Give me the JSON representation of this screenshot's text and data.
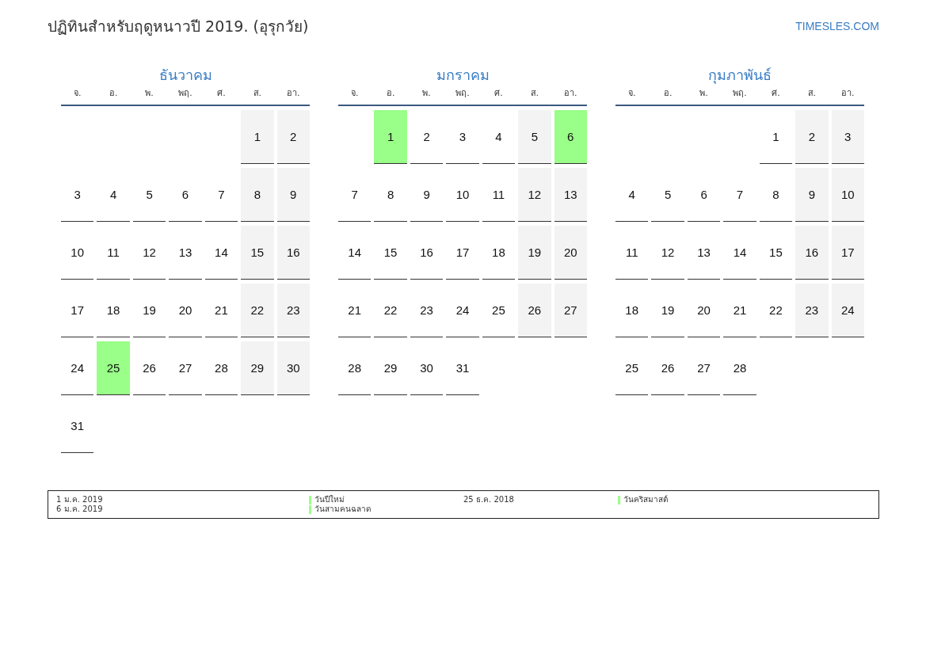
{
  "title": "ปฏิทินสำหรับฤดูหนาวปี 2019. (อุรุกวัย)",
  "site": "TIMESLES.COM",
  "months": [
    {
      "name": "ธันวาคม",
      "weekdays": [
        "จ.",
        "อ.",
        "พ.",
        "พฤ.",
        "ศ.",
        "ส.",
        "อา."
      ],
      "weeks": [
        [
          {
            "kind": "empty"
          },
          {
            "kind": "empty"
          },
          {
            "kind": "empty"
          },
          {
            "kind": "empty"
          },
          {
            "kind": "empty"
          },
          {
            "d": "1",
            "kind": "weekend"
          },
          {
            "d": "2",
            "kind": "weekend"
          }
        ],
        [
          {
            "d": "3",
            "kind": "day"
          },
          {
            "d": "4",
            "kind": "day"
          },
          {
            "d": "5",
            "kind": "day"
          },
          {
            "d": "6",
            "kind": "day"
          },
          {
            "d": "7",
            "kind": "day"
          },
          {
            "d": "8",
            "kind": "weekend"
          },
          {
            "d": "9",
            "kind": "weekend"
          }
        ],
        [
          {
            "d": "10",
            "kind": "day"
          },
          {
            "d": "11",
            "kind": "day"
          },
          {
            "d": "12",
            "kind": "day"
          },
          {
            "d": "13",
            "kind": "day"
          },
          {
            "d": "14",
            "kind": "day"
          },
          {
            "d": "15",
            "kind": "weekend"
          },
          {
            "d": "16",
            "kind": "weekend"
          }
        ],
        [
          {
            "d": "17",
            "kind": "day"
          },
          {
            "d": "18",
            "kind": "day"
          },
          {
            "d": "19",
            "kind": "day"
          },
          {
            "d": "20",
            "kind": "day"
          },
          {
            "d": "21",
            "kind": "day"
          },
          {
            "d": "22",
            "kind": "weekend"
          },
          {
            "d": "23",
            "kind": "weekend"
          }
        ],
        [
          {
            "d": "24",
            "kind": "day"
          },
          {
            "d": "25",
            "kind": "holiday"
          },
          {
            "d": "26",
            "kind": "day"
          },
          {
            "d": "27",
            "kind": "day"
          },
          {
            "d": "28",
            "kind": "day"
          },
          {
            "d": "29",
            "kind": "weekend"
          },
          {
            "d": "30",
            "kind": "weekend"
          }
        ],
        [
          {
            "d": "31",
            "kind": "day"
          }
        ]
      ]
    },
    {
      "name": "มกราคม",
      "weekdays": [
        "จ.",
        "อ.",
        "พ.",
        "พฤ.",
        "ศ.",
        "ส.",
        "อา."
      ],
      "weeks": [
        [
          {
            "kind": "empty"
          },
          {
            "d": "1",
            "kind": "holiday"
          },
          {
            "d": "2",
            "kind": "day"
          },
          {
            "d": "3",
            "kind": "day"
          },
          {
            "d": "4",
            "kind": "day"
          },
          {
            "d": "5",
            "kind": "weekend"
          },
          {
            "d": "6",
            "kind": "holiday"
          }
        ],
        [
          {
            "d": "7",
            "kind": "day"
          },
          {
            "d": "8",
            "kind": "day"
          },
          {
            "d": "9",
            "kind": "day"
          },
          {
            "d": "10",
            "kind": "day"
          },
          {
            "d": "11",
            "kind": "day"
          },
          {
            "d": "12",
            "kind": "weekend"
          },
          {
            "d": "13",
            "kind": "weekend"
          }
        ],
        [
          {
            "d": "14",
            "kind": "day"
          },
          {
            "d": "15",
            "kind": "day"
          },
          {
            "d": "16",
            "kind": "day"
          },
          {
            "d": "17",
            "kind": "day"
          },
          {
            "d": "18",
            "kind": "day"
          },
          {
            "d": "19",
            "kind": "weekend"
          },
          {
            "d": "20",
            "kind": "weekend"
          }
        ],
        [
          {
            "d": "21",
            "kind": "day"
          },
          {
            "d": "22",
            "kind": "day"
          },
          {
            "d": "23",
            "kind": "day"
          },
          {
            "d": "24",
            "kind": "day"
          },
          {
            "d": "25",
            "kind": "day"
          },
          {
            "d": "26",
            "kind": "weekend"
          },
          {
            "d": "27",
            "kind": "weekend"
          }
        ],
        [
          {
            "d": "28",
            "kind": "day"
          },
          {
            "d": "29",
            "kind": "day"
          },
          {
            "d": "30",
            "kind": "day"
          },
          {
            "d": "31",
            "kind": "day"
          }
        ]
      ]
    },
    {
      "name": "กุมภาพันธ์",
      "weekdays": [
        "จ.",
        "อ.",
        "พ.",
        "พฤ.",
        "ศ.",
        "ส.",
        "อา."
      ],
      "weeks": [
        [
          {
            "kind": "empty"
          },
          {
            "kind": "empty"
          },
          {
            "kind": "empty"
          },
          {
            "kind": "empty"
          },
          {
            "d": "1",
            "kind": "day"
          },
          {
            "d": "2",
            "kind": "weekend"
          },
          {
            "d": "3",
            "kind": "weekend"
          }
        ],
        [
          {
            "d": "4",
            "kind": "day"
          },
          {
            "d": "5",
            "kind": "day"
          },
          {
            "d": "6",
            "kind": "day"
          },
          {
            "d": "7",
            "kind": "day"
          },
          {
            "d": "8",
            "kind": "day"
          },
          {
            "d": "9",
            "kind": "weekend"
          },
          {
            "d": "10",
            "kind": "weekend"
          }
        ],
        [
          {
            "d": "11",
            "kind": "day"
          },
          {
            "d": "12",
            "kind": "day"
          },
          {
            "d": "13",
            "kind": "day"
          },
          {
            "d": "14",
            "kind": "day"
          },
          {
            "d": "15",
            "kind": "day"
          },
          {
            "d": "16",
            "kind": "weekend"
          },
          {
            "d": "17",
            "kind": "weekend"
          }
        ],
        [
          {
            "d": "18",
            "kind": "day"
          },
          {
            "d": "19",
            "kind": "day"
          },
          {
            "d": "20",
            "kind": "day"
          },
          {
            "d": "21",
            "kind": "day"
          },
          {
            "d": "22",
            "kind": "day"
          },
          {
            "d": "23",
            "kind": "weekend"
          },
          {
            "d": "24",
            "kind": "weekend"
          }
        ],
        [
          {
            "d": "25",
            "kind": "day"
          },
          {
            "d": "26",
            "kind": "day"
          },
          {
            "d": "27",
            "kind": "day"
          },
          {
            "d": "28",
            "kind": "day"
          }
        ]
      ]
    }
  ],
  "legend": [
    {
      "entries": [
        {
          "date": "1 ม.ค. 2019",
          "name": "วันปีใหม่",
          "color": "#99ff88"
        },
        {
          "date": "6 ม.ค. 2019",
          "name": "วันสามคนฉลาด",
          "color": "#99ff88"
        }
      ]
    },
    {
      "entries": [
        {
          "date": "25 ธ.ค. 2018",
          "name": "วันคริสมาสต์",
          "color": "#99ff88"
        }
      ]
    }
  ]
}
